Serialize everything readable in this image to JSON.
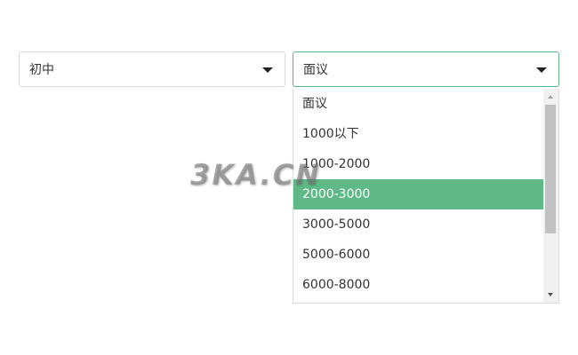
{
  "education_select": {
    "value": "初中"
  },
  "salary_select": {
    "value": "面议",
    "options": [
      {
        "label": "面议",
        "selected": false
      },
      {
        "label": "1000以下",
        "selected": false
      },
      {
        "label": "1000-2000",
        "selected": false
      },
      {
        "label": "2000-3000",
        "selected": true
      },
      {
        "label": "3000-5000",
        "selected": false
      },
      {
        "label": "5000-6000",
        "selected": false
      },
      {
        "label": "6000-8000",
        "selected": false
      }
    ]
  },
  "watermark": {
    "text": "3KA.CN"
  },
  "colors": {
    "accent": "#5fb987",
    "border": "#dcdcdc",
    "text": "#333333"
  },
  "icons": {
    "caret": "chevron-down-icon",
    "scroll_up": "arrow-up-icon",
    "scroll_down": "arrow-down-icon"
  }
}
